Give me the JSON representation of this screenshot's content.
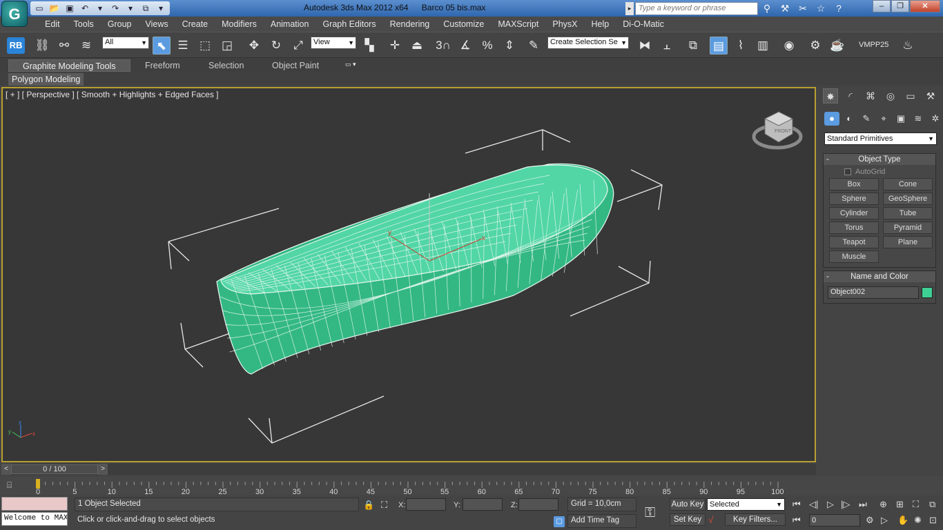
{
  "title_bar": {
    "app_title": "Autodesk 3ds Max  2012 x64",
    "file_name": "Barco 05 bis.max",
    "search_placeholder": "Type a keyword or phrase",
    "logo_letter": "G"
  },
  "menu": [
    "Edit",
    "Tools",
    "Group",
    "Views",
    "Create",
    "Modifiers",
    "Animation",
    "Graph Editors",
    "Rendering",
    "Customize",
    "MAXScript",
    "PhysX",
    "Help",
    "Di-O-Matic"
  ],
  "toolbar": {
    "rb_label": "RB",
    "selection_filter": "All",
    "reference_coord": "View",
    "named_selection_placeholder": "Create Selection Se",
    "snap_label": "3",
    "vmpp_label": "VMPP25"
  },
  "ribbon": {
    "tabs": [
      "Graphite Modeling Tools",
      "Freeform",
      "Selection",
      "Object Paint"
    ],
    "subtab": "Polygon Modeling"
  },
  "viewport": {
    "label": "[ + ] [ Perspective ] [ Smooth + Highlights + Edged Faces ]",
    "viewcube_face": "FRONT",
    "axis_x": "x",
    "axis_y": "y",
    "axis_z": "z"
  },
  "command_panel": {
    "category": "Standard Primitives",
    "object_type_title": "Object Type",
    "autogrid_label": "AutoGrid",
    "object_buttons": [
      "Box",
      "Cone",
      "Sphere",
      "GeoSphere",
      "Cylinder",
      "Tube",
      "Torus",
      "Pyramid",
      "Teapot",
      "Plane",
      "Muscle"
    ],
    "name_color_title": "Name and Color",
    "object_name": "Object002",
    "object_color": "#3ecf95"
  },
  "time": {
    "frame_display": "0 / 100",
    "ticks": [
      "0",
      "5",
      "10",
      "15",
      "20",
      "25",
      "30",
      "35",
      "40",
      "45",
      "50",
      "55",
      "60",
      "65",
      "70",
      "75",
      "80",
      "85",
      "90",
      "95",
      "100"
    ]
  },
  "status": {
    "listener_text": "Welcome to MAXScript.",
    "selection_info": "1 Object Selected",
    "prompt": "Click or click-and-drag to select objects",
    "x_label": "X:",
    "y_label": "Y:",
    "z_label": "Z:",
    "grid": "Grid = 10,0cm",
    "add_time_tag": "Add Time Tag",
    "auto_key": "Auto Key",
    "set_key": "Set Key",
    "key_mode": "Selected",
    "key_filters": "Key Filters...",
    "current_frame": "0"
  },
  "colors": {
    "viewport_border": "#b8a030",
    "hull": "#3ecf95",
    "active_blue": "#5b9be0"
  }
}
